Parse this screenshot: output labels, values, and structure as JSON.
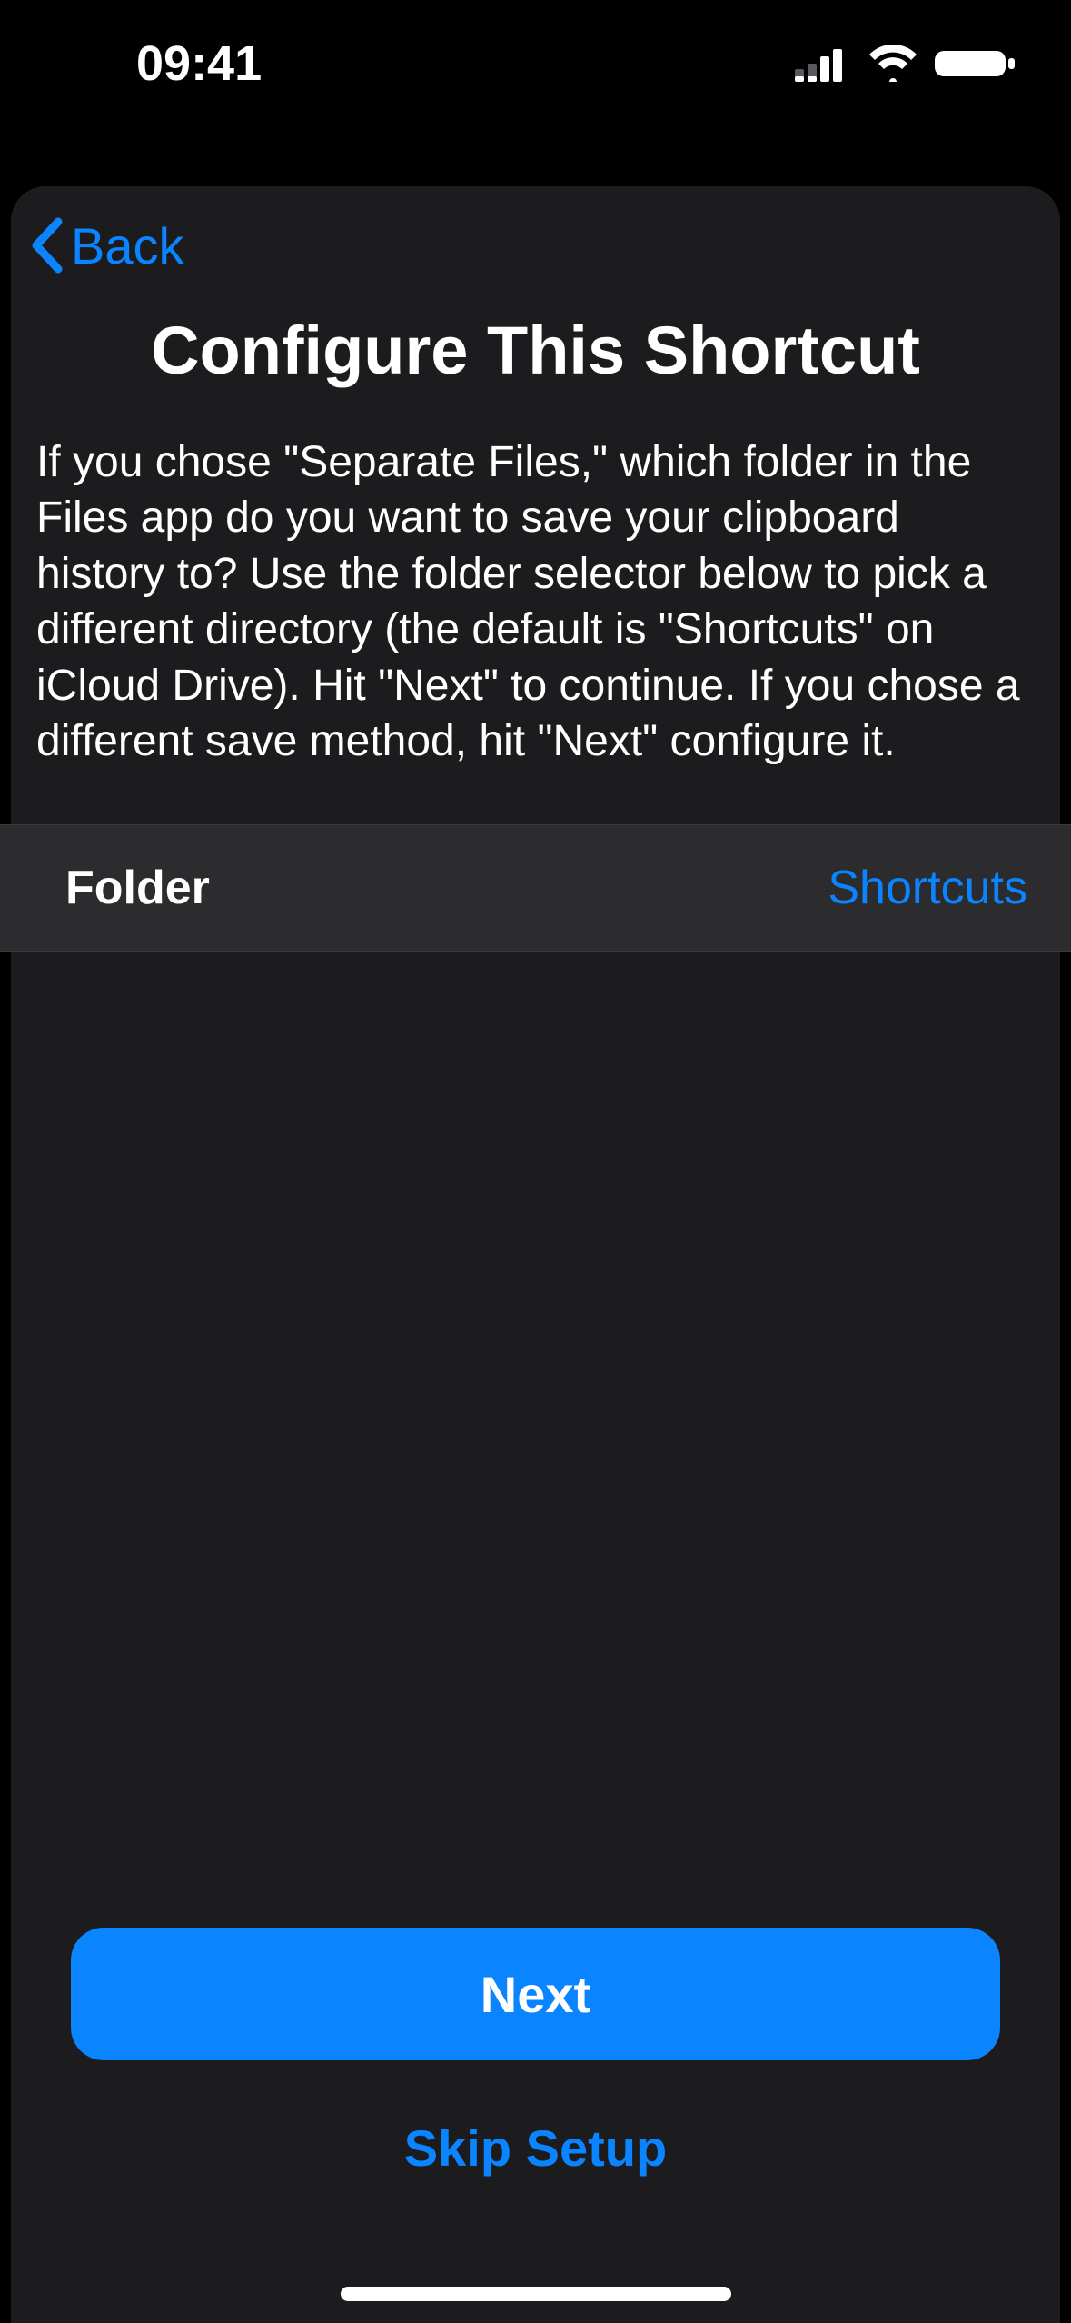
{
  "statusBar": {
    "time": "09:41"
  },
  "nav": {
    "backLabel": "Back"
  },
  "page": {
    "title": "Configure This Shortcut",
    "description": "If you chose \"Separate Files,\" which folder in the Files app do you want to save your clipboard history to? Use the folder selector below to pick a different directory (the default is \"Shortcuts\" on iCloud Drive). Hit \"Next\" to continue. If you chose a different save method, hit \"Next\" configure it."
  },
  "folderRow": {
    "label": "Folder",
    "value": "Shortcuts"
  },
  "actions": {
    "primary": "Next",
    "secondary": "Skip Setup"
  }
}
